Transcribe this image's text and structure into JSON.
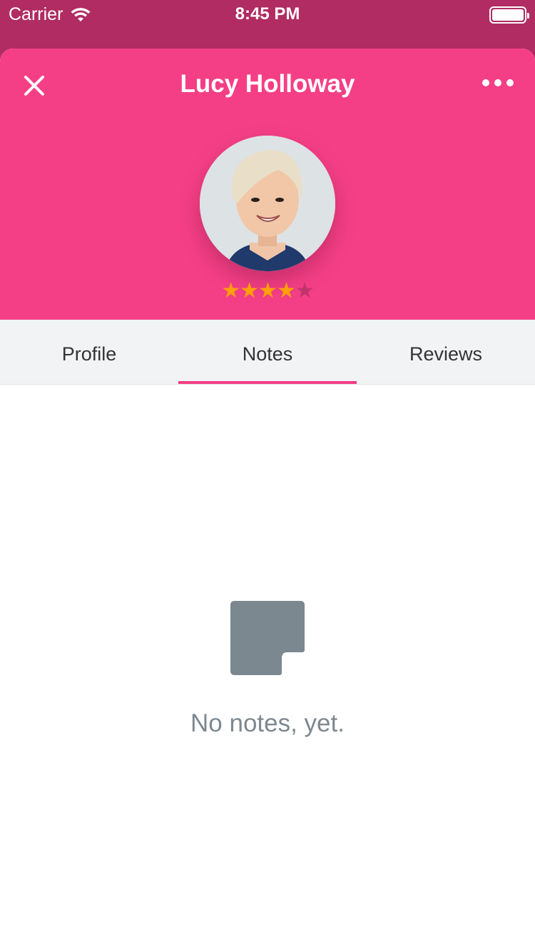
{
  "status_bar": {
    "carrier": "Carrier",
    "time": "8:45 PM"
  },
  "header": {
    "title": "Lucy Holloway",
    "rating": 4,
    "rating_max": 5
  },
  "tabs": [
    {
      "label": "Profile",
      "active": false
    },
    {
      "label": "Notes",
      "active": true
    },
    {
      "label": "Reviews",
      "active": false
    }
  ],
  "empty_state": {
    "message": "No notes, yet."
  },
  "colors": {
    "accent": "#f43f86",
    "star": "#ff9f0a",
    "muted_text": "#7d8890",
    "icon": "#7c888f"
  }
}
